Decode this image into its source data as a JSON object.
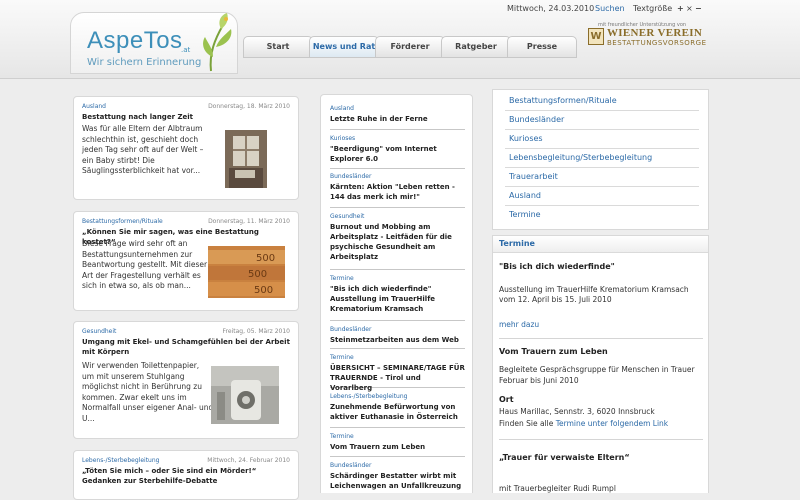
{
  "header": {
    "logo": {
      "name": "AspeTos",
      "suffix": ".at",
      "tagline": "Wir sichern Erinnerung"
    },
    "topbar": {
      "date": "Mittwoch, 24.03.2010",
      "search": "Suchen",
      "textsize_label": "Textgröße",
      "plus": "+",
      "reset": "×",
      "minus": "−"
    },
    "nav": [
      {
        "label": "Start"
      },
      {
        "label": "News und Rat",
        "active": true
      },
      {
        "label": "Förderer"
      },
      {
        "label": "Ratgeber"
      },
      {
        "label": "Presse"
      }
    ],
    "sponsor": {
      "note": "mit freundlicher Unterstützung von",
      "emblem": "W",
      "name": "WIENER VEREIN",
      "sub": "BESTATTUNGSVORSORGE"
    }
  },
  "articles": [
    {
      "category": "Ausland",
      "date": "Donnerstag, 18. März 2010",
      "title": "Bestattung nach langer Zeit",
      "lines": [
        "Was für alle Eltern der Albtraum",
        "schlechthin ist, geschieht doch",
        "jeden Tag sehr oft auf der Welt –",
        "ein Baby stirbt! Die",
        "Säuglingssterblichkeit hat vor..."
      ]
    },
    {
      "category": "Bestattungsformen/Rituale",
      "date": "Donnerstag, 11. März 2010",
      "title": "„Können Sie mir sagen, was eine Bestattung kostet?“",
      "lines": [
        "Diese Frage wird sehr oft an",
        "Bestattungsunternehmen zur",
        "Beantwortung gestellt. Mit dieser",
        "Art der Fragestellung verhält es",
        "sich in etwa so, als ob man..."
      ]
    },
    {
      "category": "Gesundheit",
      "date": "Freitag, 05. März 2010",
      "title": "Umgang mit Ekel- und Schamgefühlen bei der Arbeit mit Körpern",
      "lines": [
        "Wir verwenden Toilettenpapier,",
        "um mit unserem Stuhlgang",
        "möglichst nicht in Berührung zu",
        "kommen. Zwar ekelt uns im",
        "Normalfall unser eigener Anal- und",
        "U..."
      ]
    },
    {
      "category": "Lebens-/Sterbebegleitung",
      "date": "Mittwoch, 24. Februar 2010",
      "title": "„Töten Sie mich – oder Sie sind ein Mörder!“ Gedanken zur Sterbehilfe-Debatte",
      "lines": []
    }
  ],
  "news": [
    {
      "category": "Ausland",
      "title": "Letzte Ruhe in der Ferne"
    },
    {
      "category": "Kurioses",
      "title": "\"Beerdigung\" vom Internet Explorer 6.0"
    },
    {
      "category": "Bundesländer",
      "title": "Kärnten: Aktion \"Leben retten - 144 das merk ich mir!\""
    },
    {
      "category": "Gesundheit",
      "title": "Burnout und Mobbing am Arbeitsplatz - Leitfäden für die psychische Gesundheit am Arbeitsplatz"
    },
    {
      "category": "Termine",
      "title": "\"Bis ich dich wiederfinde\" Ausstellung im TrauerHilfe Krematorium Kramsach"
    },
    {
      "category": "Bundesländer",
      "title": "Steinmetzarbeiten aus dem Web"
    },
    {
      "category": "Termine",
      "title": "ÜBERSICHT – SEMINARE/TAGE FÜR TRAUERNDE - Tirol und Vorarlberg"
    },
    {
      "category": "Lebens-/Sterbebegleitung",
      "title": "Zunehmende Befürwortung von aktiver Euthanasie in Österreich"
    },
    {
      "category": "Termine",
      "title": "Vom Trauern zum Leben"
    },
    {
      "category": "Bundesländer",
      "title": "Schärdinger Bestatter wirbt mit Leichenwagen an Unfallkreuzung"
    }
  ],
  "categories": [
    "Bestattungsformen/Rituale",
    "Bundesländer",
    "Kurioses",
    "Lebensbegleitung/Sterbebegleitung",
    "Trauerarbeit",
    "Ausland",
    "Termine"
  ],
  "termine": {
    "title": "Termine",
    "events": [
      {
        "title": "\"Bis ich dich wiederfinde\"",
        "line1": "Ausstellung im TrauerHilfe Krematorium Kramsach",
        "line2": "vom 12. April bis 15. Juli 2010",
        "more": "mehr dazu"
      },
      {
        "title": "Vom Trauern zum Leben",
        "line1": "Begleitete Gesprächsgruppe für Menschen in Trauer",
        "line2": "Februar bis Juni 2010",
        "ort_label": "Ort",
        "ort": "Haus Marillac, Sennstr. 3, 6020 Innsbruck",
        "find_prefix": "Finden Sie alle ",
        "find_link": "Termine unter folgendem Link"
      },
      {
        "title": "„Trauer für verwaiste Eltern“",
        "line1": "mit  Trauerbegleiter Rudi Rumpl"
      }
    ]
  },
  "colors": {
    "accent": "#2c6aa7",
    "background": "#ededed",
    "sponsor": "#8a6d2a"
  }
}
